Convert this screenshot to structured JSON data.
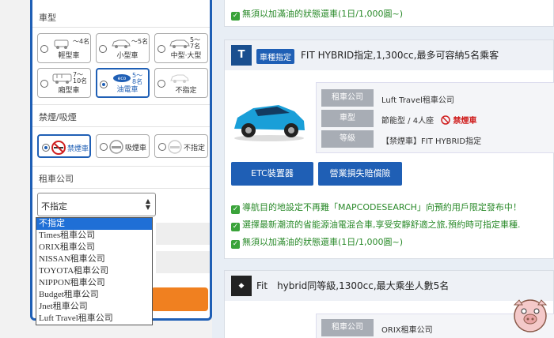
{
  "sidebar": {
    "car_type_title": "車型",
    "car_types": [
      {
        "label": "輕型車",
        "cap": "～4名",
        "icon": "kei-car-icon",
        "selected": false
      },
      {
        "label": "小型車",
        "cap": "～5名",
        "icon": "compact-car-icon",
        "selected": false
      },
      {
        "label": "中型‧大型",
        "cap": "5～\n7名",
        "icon": "large-car-icon",
        "selected": false
      },
      {
        "label": "廂型車",
        "cap": "7～\n10名",
        "icon": "van-icon",
        "selected": false
      },
      {
        "label": "油電車",
        "cap": "5～\n8名",
        "icon": "eco-car-icon",
        "selected": true
      },
      {
        "label": "不指定",
        "cap": "",
        "icon": "any-car-icon",
        "selected": false
      }
    ],
    "smoke_title": "禁煙/吸煙",
    "smoke_options": [
      {
        "label": "禁煙車",
        "selected": true
      },
      {
        "label": "吸煙車",
        "selected": false
      },
      {
        "label": "不指定",
        "selected": false
      }
    ],
    "company_title": "租車公司",
    "company_select_value": "不指定",
    "company_options": [
      "不指定",
      "Times租車公司",
      "ORIX租車公司",
      "NISSAN租車公司",
      "TOYOTA租車公司",
      "NIPPON租車公司",
      "Budget租車公司",
      "Jnet租車公司",
      "Luft Travel租車公司"
    ]
  },
  "listing_top": {
    "note": "無須以加滿油的狀態還車(1日/1,000圓~)"
  },
  "listing1": {
    "badge": "車種指定",
    "title": "FIT HYBRID指定,1,300cc,最多可容納5名乘客",
    "logo_text": "T",
    "rows": [
      {
        "key": "租車公司",
        "value": "Luft Travel租車公司"
      },
      {
        "key": "車型",
        "value": "節能型 / 4人座",
        "extra": "禁煙車"
      },
      {
        "key": "等級",
        "value": "【禁煙車】FIT HYBRID指定"
      }
    ],
    "buttons": [
      "ETC裝置器",
      "營業損失賠償險"
    ],
    "notes": [
      "導航目的地設定不再難「MAPCODESEARCH」向預約用戶限定發布中！",
      "選擇最新潮流的省能源油電混合車,享受安靜舒適之旅,預約時可指定車種.",
      "無須以加滿油的狀態還車(1日/1,000圓~)"
    ]
  },
  "listing2": {
    "title": "Fit　hybrid同等級,1300cc,最大乘坐人數5名",
    "rows": [
      {
        "key": "租車公司",
        "value": "ORIX租車公司"
      }
    ]
  },
  "colors": {
    "accent": "#1f5fb5",
    "orange": "#f08020",
    "green": "#2a8a2a",
    "red": "#d02020"
  }
}
